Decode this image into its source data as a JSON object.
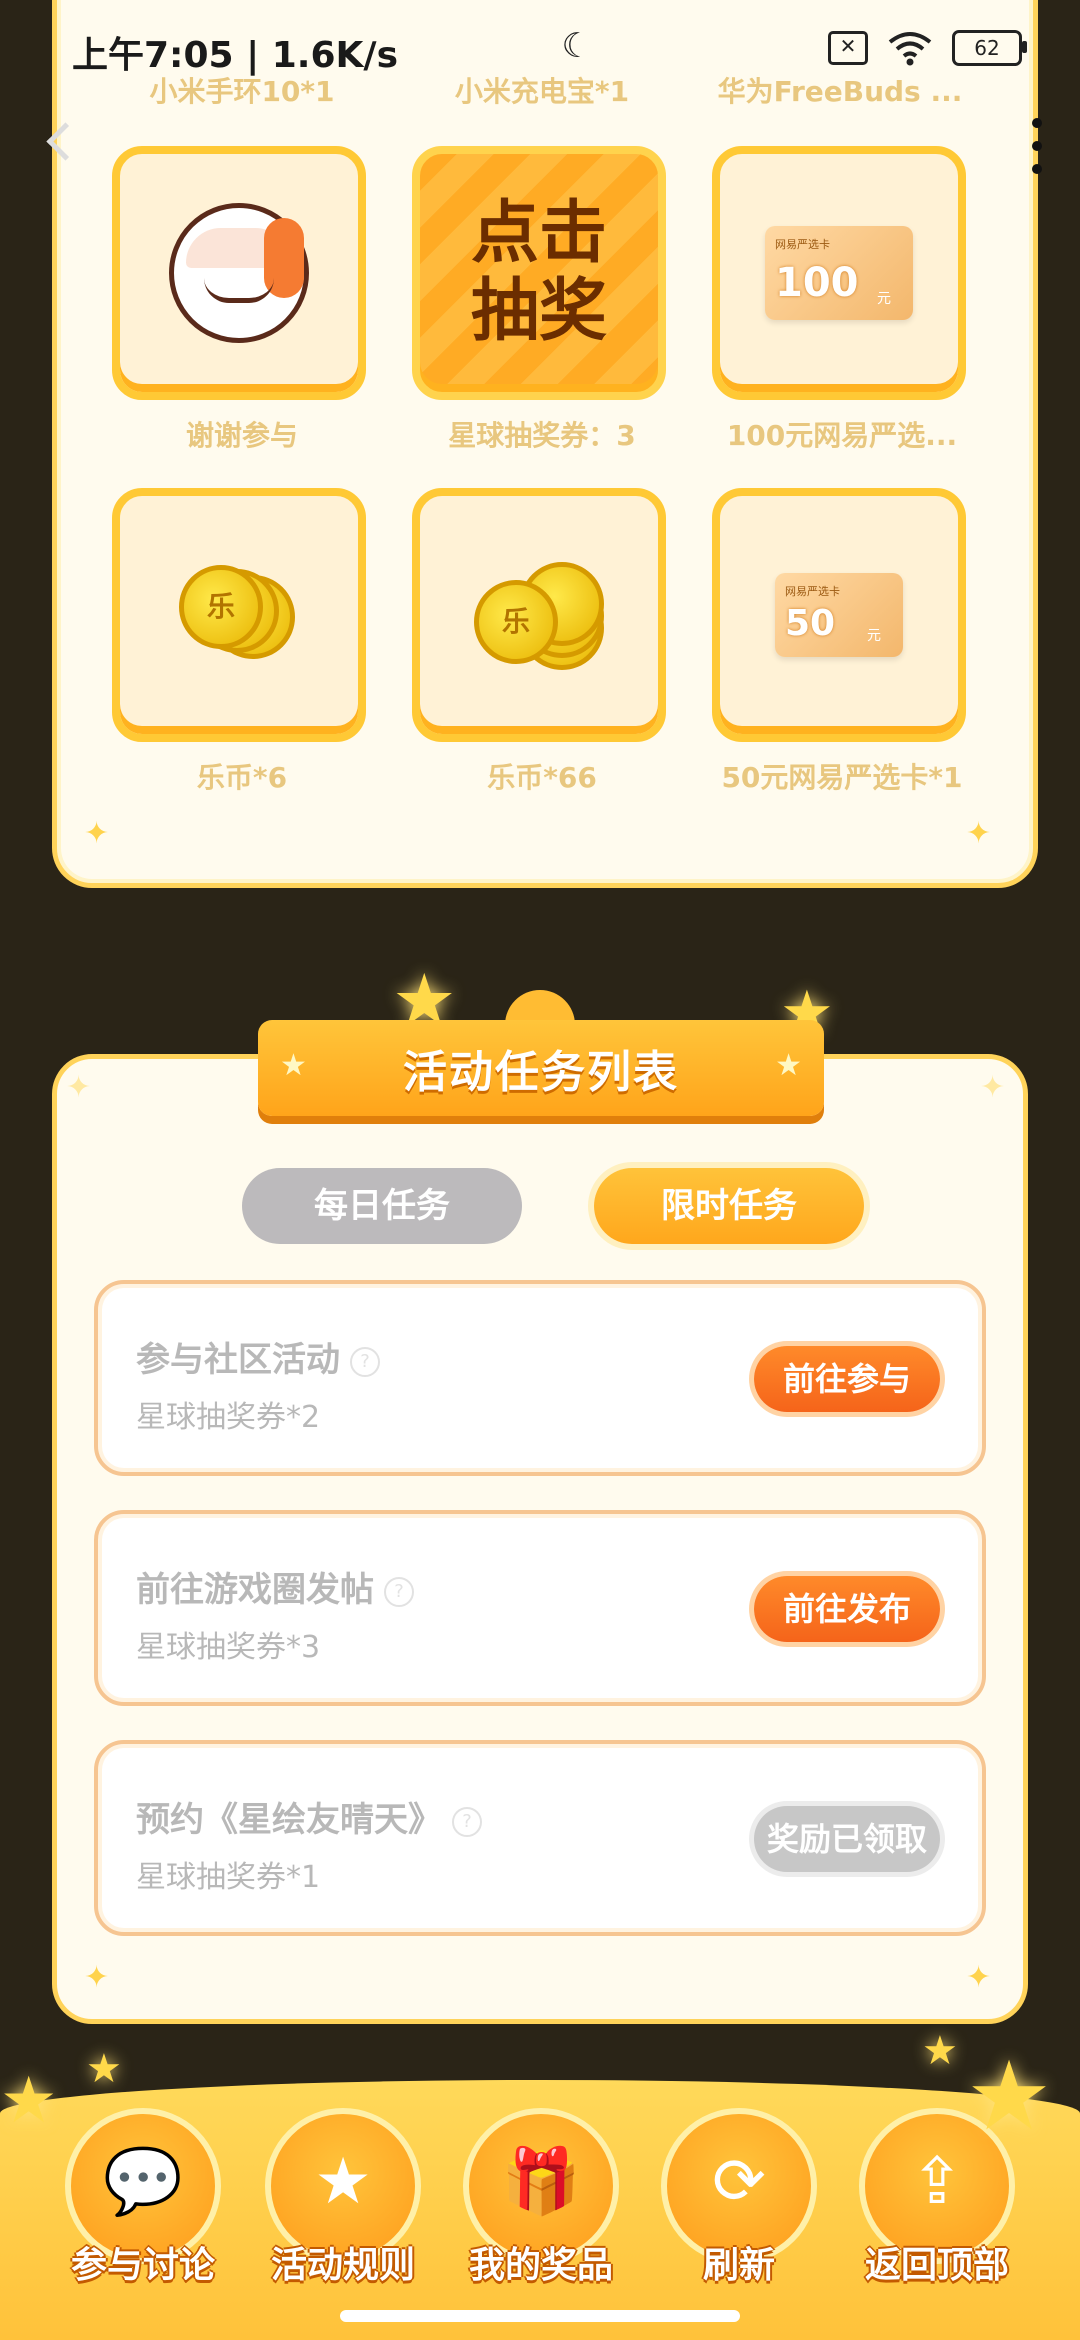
{
  "status_bar": {
    "time": "上午7:05 | 1.6K/s",
    "battery": "62",
    "icons": [
      "moon-icon",
      "sim-off-icon",
      "wifi-icon",
      "battery-icon"
    ]
  },
  "prizes": {
    "top_row_labels": [
      "小米手环10*1",
      "小米充电宝*1",
      "华为FreeBuds ..."
    ],
    "items": [
      {
        "label": "谢谢参与",
        "icon": "mascot-face-icon"
      },
      {
        "label": "星球抽奖券：3",
        "draw_text_line1": "点击",
        "draw_text_line2": "抽奖"
      },
      {
        "label": "100元网易严选...",
        "card_amount": "100",
        "card_unit": "元",
        "card_tag": "网易严选卡"
      },
      {
        "label": "乐币*6",
        "coin_char": "乐"
      },
      {
        "label": "乐币*66",
        "coin_char": "乐"
      },
      {
        "label": "50元网易严选卡*1",
        "card_amount": "50",
        "card_unit": "元",
        "card_tag": "网易严选卡"
      }
    ]
  },
  "task_panel": {
    "title": "活动任务列表",
    "tabs": [
      {
        "label": "每日任务",
        "active": false
      },
      {
        "label": "限时任务",
        "active": true
      }
    ],
    "tasks": [
      {
        "title": "参与社区活动",
        "reward": "星球抽奖券*2",
        "button": "前往参与",
        "done": false
      },
      {
        "title": "前往游戏圈发帖",
        "reward": "星球抽奖券*3",
        "button": "前往发布",
        "done": false
      },
      {
        "title": "预约《星绘友晴天》",
        "reward": "星球抽奖券*1",
        "button": "奖励已领取",
        "done": true
      }
    ]
  },
  "bottom_nav": [
    {
      "label": "参与讨论",
      "icon": "chat-icon",
      "glyph": "💬"
    },
    {
      "label": "活动规则",
      "icon": "star-search-icon",
      "glyph": "★"
    },
    {
      "label": "我的奖品",
      "icon": "gift-icon",
      "glyph": "🎁"
    },
    {
      "label": "刷新",
      "icon": "refresh-icon",
      "glyph": "⟳"
    },
    {
      "label": "返回顶部",
      "icon": "upload-arrow-icon",
      "glyph": "⇪"
    }
  ],
  "colors": {
    "accent_orange": "#ffa41a",
    "button_orange": "#f5641a",
    "panel_bg": "#fffbee",
    "page_bg": "#2a2417"
  }
}
